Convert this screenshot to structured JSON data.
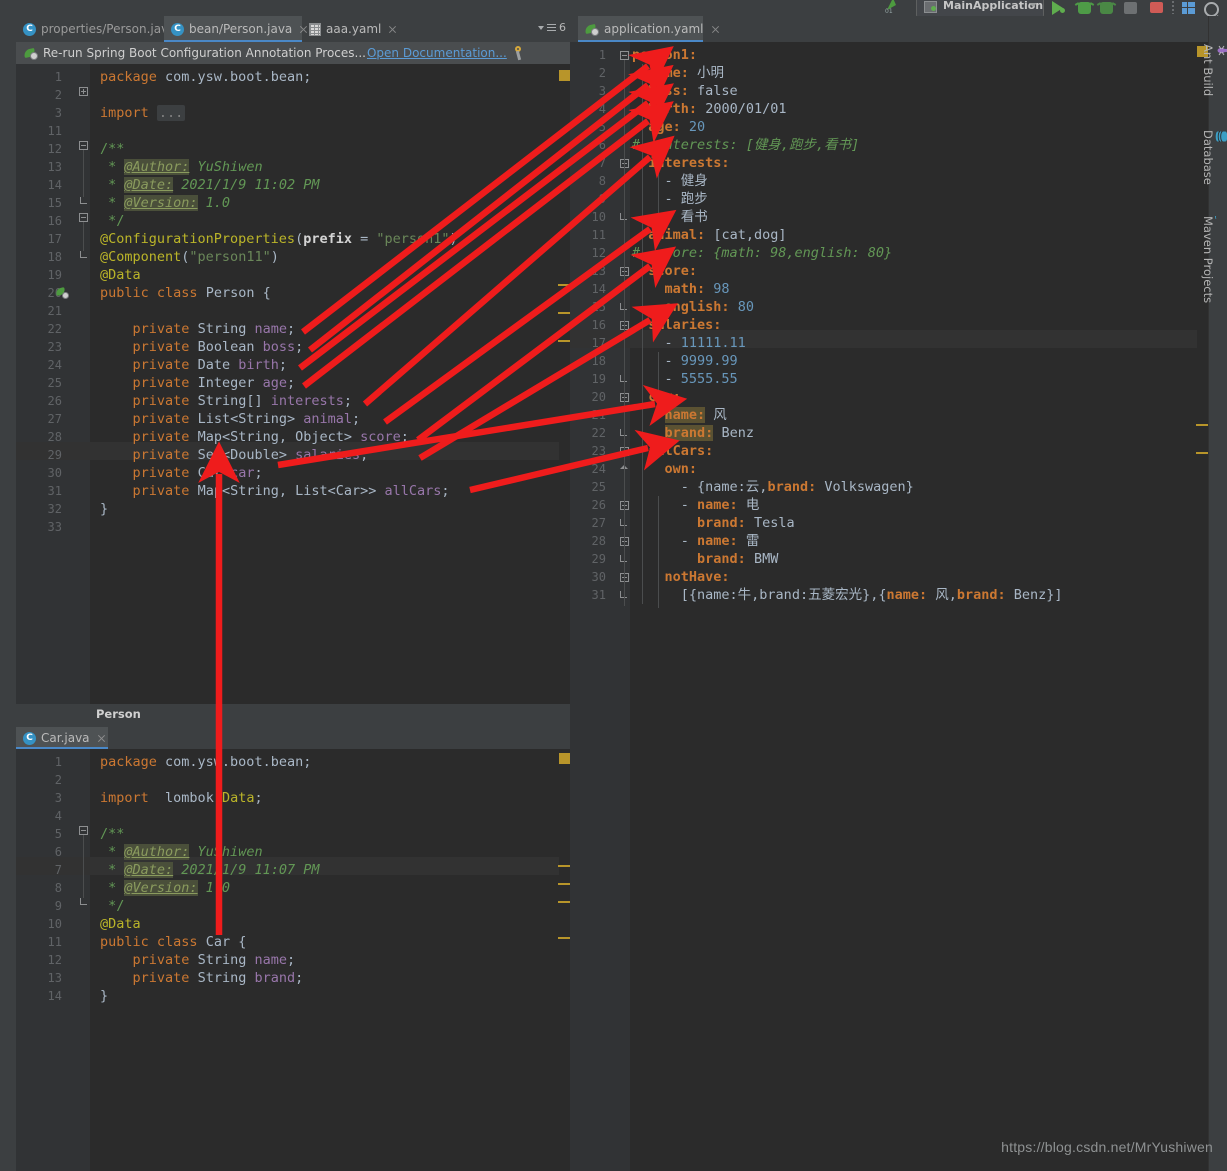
{
  "toolbar": {
    "run_config": "MainApplication",
    "icons": [
      "run-icon",
      "debug-icon",
      "coverage-icon",
      "profile-icon",
      "stop-icon",
      "layout-icon",
      "search-everywhere-icon"
    ]
  },
  "left_pane": {
    "tabs": [
      {
        "label": "properties/Person.java",
        "icon": "java-class-icon",
        "active": false,
        "closable": true
      },
      {
        "label": "bean/Person.java",
        "icon": "java-class-icon",
        "active": true,
        "closable": true
      },
      {
        "label": "aaa.yaml",
        "icon": "yaml-file-icon",
        "active": false,
        "closable": true
      }
    ],
    "tab_count": "6",
    "notification": {
      "text": "Re-run Spring Boot Configuration Annotation Proces...",
      "link": "Open Documentation...",
      "icon": "spring-leaf-icon",
      "settings_icon": "wrench-icon"
    },
    "breadcrumb": "Person",
    "editor": {
      "file": "bean/Person.java",
      "lines": [
        {
          "n": "1",
          "text": "package com.ysw.boot.bean;"
        },
        {
          "n": "2",
          "text": ""
        },
        {
          "n": "3",
          "text": "import ..."
        },
        {
          "n": "11",
          "text": ""
        },
        {
          "n": "12",
          "text": "/**"
        },
        {
          "n": "13",
          "text": " * @Author: YuShiwen"
        },
        {
          "n": "14",
          "text": " * @Date: 2021/1/9 11:02 PM"
        },
        {
          "n": "15",
          "text": " * @Version: 1.0"
        },
        {
          "n": "16",
          "text": " */"
        },
        {
          "n": "17",
          "text": "@ConfigurationProperties(prefix = \"person1\")"
        },
        {
          "n": "18",
          "text": "@Component(\"person11\")"
        },
        {
          "n": "19",
          "text": "@Data"
        },
        {
          "n": "20",
          "text": "public class Person {"
        },
        {
          "n": "21",
          "text": ""
        },
        {
          "n": "22",
          "text": "    private String name;"
        },
        {
          "n": "23",
          "text": "    private Boolean boss;"
        },
        {
          "n": "24",
          "text": "    private Date birth;"
        },
        {
          "n": "25",
          "text": "    private Integer age;"
        },
        {
          "n": "26",
          "text": "    private String[] interests;"
        },
        {
          "n": "27",
          "text": "    private List<String> animal;"
        },
        {
          "n": "28",
          "text": "    private Map<String, Object> score;"
        },
        {
          "n": "29",
          "text": "    private Set<Double> salaries;"
        },
        {
          "n": "30",
          "text": "    private Car car;"
        },
        {
          "n": "31",
          "text": "    private Map<String, List<Car>> allCars;"
        },
        {
          "n": "32",
          "text": "}"
        },
        {
          "n": "33",
          "text": ""
        }
      ]
    }
  },
  "bottom_pane": {
    "tabs": [
      {
        "label": "Car.java",
        "icon": "java-class-icon",
        "active": true,
        "closable": true
      }
    ],
    "editor": {
      "file": "Car.java",
      "lines": [
        {
          "n": "1",
          "text": "package com.ysw.boot.bean;"
        },
        {
          "n": "2",
          "text": ""
        },
        {
          "n": "3",
          "text": "import lombok.Data;"
        },
        {
          "n": "4",
          "text": ""
        },
        {
          "n": "5",
          "text": "/**"
        },
        {
          "n": "6",
          "text": " * @Author: YuShiwen"
        },
        {
          "n": "7",
          "text": " * @Date: 2021/1/9 11:07 PM"
        },
        {
          "n": "8",
          "text": " * @Version: 1.0"
        },
        {
          "n": "9",
          "text": " */"
        },
        {
          "n": "10",
          "text": "@Data"
        },
        {
          "n": "11",
          "text": "public class Car {"
        },
        {
          "n": "12",
          "text": "    private String name;"
        },
        {
          "n": "13",
          "text": "    private String brand;"
        },
        {
          "n": "14",
          "text": "}"
        }
      ]
    }
  },
  "right_pane": {
    "tabs": [
      {
        "label": "application.yaml",
        "icon": "spring-yaml-icon",
        "active": true,
        "closable": true
      }
    ],
    "editor": {
      "file": "application.yaml",
      "lines": [
        {
          "n": "1",
          "text": "person1:"
        },
        {
          "n": "2",
          "text": "  name: 小明"
        },
        {
          "n": "3",
          "text": "  boss: false"
        },
        {
          "n": "4",
          "text": "  birth: 2000/01/01"
        },
        {
          "n": "5",
          "text": "  age: 20"
        },
        {
          "n": "6",
          "text": "#  interests: [健身,跑步,看书]"
        },
        {
          "n": "7",
          "text": "  interests:"
        },
        {
          "n": "8",
          "text": "    - 健身"
        },
        {
          "n": "9",
          "text": "    - 跑步"
        },
        {
          "n": "10",
          "text": "    - 看书"
        },
        {
          "n": "11",
          "text": "  animal: [cat,dog]"
        },
        {
          "n": "12",
          "text": "#  score: {math: 98,english: 80}"
        },
        {
          "n": "13",
          "text": "  score:"
        },
        {
          "n": "14",
          "text": "    math: 98"
        },
        {
          "n": "15",
          "text": "    english: 80"
        },
        {
          "n": "16",
          "text": "  salaries:"
        },
        {
          "n": "17",
          "text": "    - 11111.11"
        },
        {
          "n": "18",
          "text": "    - 9999.99"
        },
        {
          "n": "19",
          "text": "    - 5555.55"
        },
        {
          "n": "20",
          "text": "  car:"
        },
        {
          "n": "21",
          "text": "    name: 风"
        },
        {
          "n": "22",
          "text": "    brand: Benz"
        },
        {
          "n": "23",
          "text": "  allCars:"
        },
        {
          "n": "24",
          "text": "    own:"
        },
        {
          "n": "25",
          "text": "      - {name:云,brand: Volkswagen}"
        },
        {
          "n": "26",
          "text": "      - name: 电"
        },
        {
          "n": "27",
          "text": "        brand: Tesla"
        },
        {
          "n": "28",
          "text": "      - name: 雷"
        },
        {
          "n": "29",
          "text": "        brand: BMW"
        },
        {
          "n": "30",
          "text": "    notHave:"
        },
        {
          "n": "31",
          "text": "      [{name:牛,brand:五菱宏光},{name: 风,brand: Benz}]"
        }
      ]
    }
  },
  "right_tool_rail": [
    {
      "label": "Ant Build",
      "icon": "ant-icon"
    },
    {
      "label": "Database",
      "icon": "database-icon"
    },
    {
      "label": "Maven Projects",
      "icon": "maven-icon"
    }
  ],
  "annotations": {
    "arrow_color": "#ef1c1c",
    "count": 10,
    "mappings": [
      {
        "from": "name field",
        "to": "name: 小明"
      },
      {
        "from": "boss field",
        "to": "boss: false"
      },
      {
        "from": "birth field",
        "to": "birth: 2000/01/01"
      },
      {
        "from": "age field",
        "to": "age: 20"
      },
      {
        "from": "interests field",
        "to": "interests:"
      },
      {
        "from": "animal field",
        "to": "animal: [cat,dog]"
      },
      {
        "from": "score field",
        "to": "score:"
      },
      {
        "from": "salaries field",
        "to": "salaries:"
      },
      {
        "from": "car field",
        "to": "car:"
      },
      {
        "from": "allCars field",
        "to": "allCars:"
      },
      {
        "from": "Car class",
        "to": "Car car; declaration"
      }
    ]
  },
  "watermark": "https://blog.csdn.net/MrYushiwen"
}
